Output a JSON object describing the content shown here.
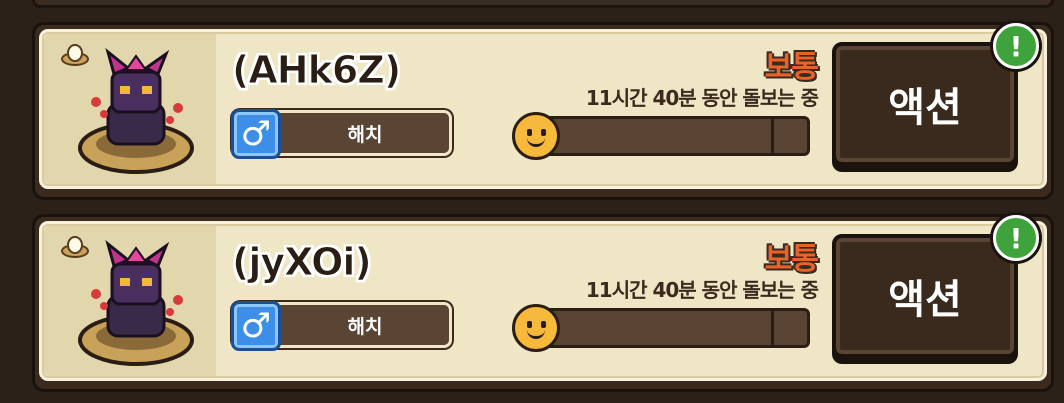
{
  "pets": [
    {
      "name": "(AHk6Z)",
      "gender_symbol": "♂",
      "stage": "해치",
      "status": "보통",
      "care_time": "11시간 40분 동안 돌보는 중",
      "care_progress": 0.06,
      "action_label": "액션",
      "alert_symbol": "!"
    },
    {
      "name": "(jyXOi)",
      "gender_symbol": "♂",
      "stage": "해치",
      "status": "보통",
      "care_time": "11시간 40분 동안 돌보는 중",
      "care_progress": 0.06,
      "action_label": "액션",
      "alert_symbol": "!"
    }
  ],
  "colors": {
    "status": "#e8622a",
    "bar_fill": "#e8622a",
    "gender_male": "#3d8ee6",
    "alert": "#3ea33a"
  },
  "icons": [
    "egg-icon",
    "pet-sprite",
    "male-gender-icon",
    "smiley-icon",
    "alert-icon"
  ]
}
